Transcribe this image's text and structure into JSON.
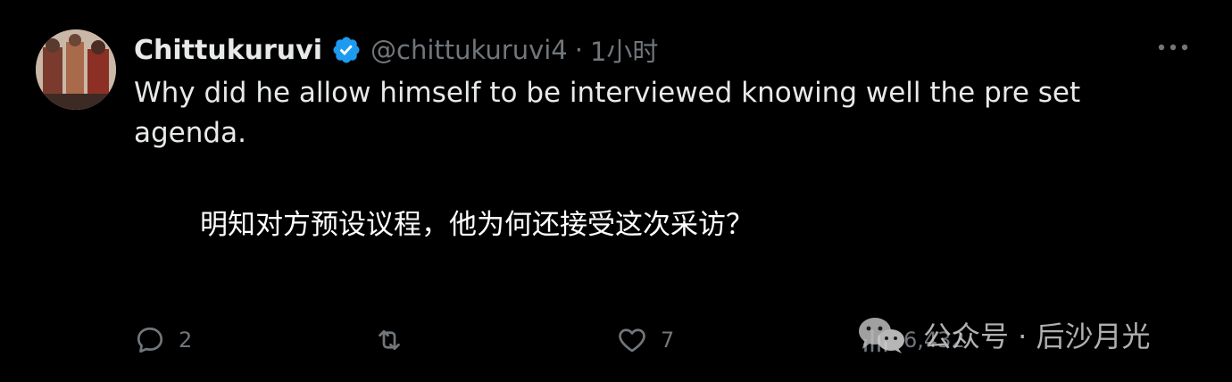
{
  "tweet": {
    "display_name": "Chittukuruvi",
    "handle": "@chittukuruvi4",
    "separator": "·",
    "time": "1小时",
    "text": "Why did he allow himself to be interviewed knowing well the pre set agenda.",
    "translation": "明知对方预设议程，他为何还接受这次采访？"
  },
  "actions": {
    "reply_count": "2",
    "retweet_count": "",
    "like_count": "7",
    "views_count": "6,432"
  },
  "watermark": {
    "text": "公众号 · 后沙月光"
  },
  "colors": {
    "background": "#000000",
    "primary_text": "#e7e9ea",
    "secondary_text": "#71767b",
    "verified_blue": "#1d9bf0"
  },
  "icons": {
    "verified": "verified-badge-icon",
    "more": "more-dots-icon",
    "reply": "reply-bubble-icon",
    "retweet": "retweet-icon",
    "like": "heart-icon",
    "views": "views-chart-icon",
    "watermark_logo": "wechat-logo-icon"
  }
}
